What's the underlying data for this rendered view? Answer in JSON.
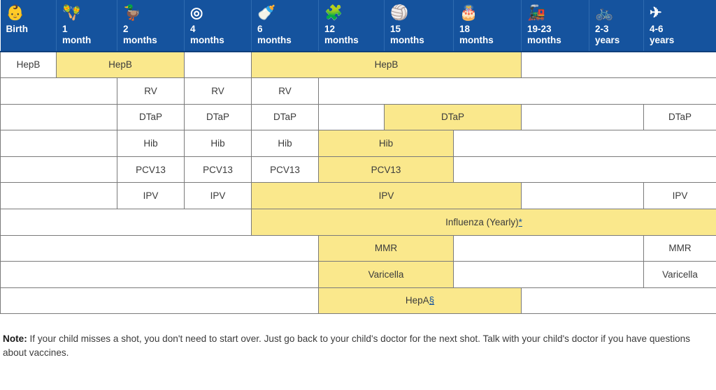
{
  "colors": {
    "header_blue": "#15539E",
    "highlight_yellow": "#FAE88C",
    "grid_line": "#7a7a7a",
    "link_blue": "#15539E"
  },
  "header": {
    "columns": [
      {
        "label": "Birth",
        "icon": "stroller-icon",
        "glyph": "👶"
      },
      {
        "label": "1\nmonth",
        "icon": "rattle-icon",
        "glyph": "🪇"
      },
      {
        "label": "2\nmonths",
        "icon": "rubber-duck-icon",
        "glyph": "🦆"
      },
      {
        "label": "4\nmonths",
        "icon": "teething-rings-icon",
        "glyph": "◎"
      },
      {
        "label": "6\nmonths",
        "icon": "bib-icon",
        "glyph": "🍼"
      },
      {
        "label": "12\nmonths",
        "icon": "building-blocks-icon",
        "glyph": "🧩"
      },
      {
        "label": "15\nmonths",
        "icon": "beach-ball-icon",
        "glyph": "🏐"
      },
      {
        "label": "18\nmonths",
        "icon": "stacking-rings-toy-icon",
        "glyph": "🎂"
      },
      {
        "label": "19-23\nmonths",
        "icon": "toy-train-icon",
        "glyph": "🚂"
      },
      {
        "label": "2-3\nyears",
        "icon": "tricycle-icon",
        "glyph": "🚲"
      },
      {
        "label": "4-6\nyears",
        "icon": "paper-airplane-icon",
        "glyph": "✈"
      }
    ]
  },
  "rows": [
    {
      "vaccine": "HepB",
      "cells": [
        {
          "label": "HepB",
          "span": 1,
          "highlight": false
        },
        {
          "label": "HepB",
          "span": 2,
          "highlight": true
        },
        {
          "label": "",
          "span": 1,
          "highlight": false
        },
        {
          "label": "HepB",
          "span": 4,
          "highlight": true
        },
        {
          "label": "",
          "span": 3,
          "highlight": false
        }
      ]
    },
    {
      "vaccine": "RV",
      "cells": [
        {
          "label": "",
          "span": 2,
          "highlight": false
        },
        {
          "label": "RV",
          "span": 1,
          "highlight": false
        },
        {
          "label": "RV",
          "span": 1,
          "highlight": false
        },
        {
          "label": "RV",
          "span": 1,
          "highlight": false
        },
        {
          "label": "",
          "span": 6,
          "highlight": false
        }
      ]
    },
    {
      "vaccine": "DTaP",
      "cells": [
        {
          "label": "",
          "span": 2,
          "highlight": false
        },
        {
          "label": "DTaP",
          "span": 1,
          "highlight": false
        },
        {
          "label": "DTaP",
          "span": 1,
          "highlight": false
        },
        {
          "label": "DTaP",
          "span": 1,
          "highlight": false
        },
        {
          "label": "",
          "span": 1,
          "highlight": false
        },
        {
          "label": "DTaP",
          "span": 2,
          "highlight": true
        },
        {
          "label": "",
          "span": 2,
          "highlight": false
        },
        {
          "label": "DTaP",
          "span": 1,
          "highlight": false
        }
      ]
    },
    {
      "vaccine": "Hib",
      "cells": [
        {
          "label": "",
          "span": 2,
          "highlight": false
        },
        {
          "label": "Hib",
          "span": 1,
          "highlight": false
        },
        {
          "label": "Hib",
          "span": 1,
          "highlight": false
        },
        {
          "label": "Hib",
          "span": 1,
          "highlight": false
        },
        {
          "label": "Hib",
          "span": 2,
          "highlight": true
        },
        {
          "label": "",
          "span": 4,
          "highlight": false
        }
      ]
    },
    {
      "vaccine": "PCV13",
      "cells": [
        {
          "label": "",
          "span": 2,
          "highlight": false
        },
        {
          "label": "PCV13",
          "span": 1,
          "highlight": false
        },
        {
          "label": "PCV13",
          "span": 1,
          "highlight": false
        },
        {
          "label": "PCV13",
          "span": 1,
          "highlight": false
        },
        {
          "label": "PCV13",
          "span": 2,
          "highlight": true
        },
        {
          "label": "",
          "span": 4,
          "highlight": false
        }
      ]
    },
    {
      "vaccine": "IPV",
      "cells": [
        {
          "label": "",
          "span": 2,
          "highlight": false
        },
        {
          "label": "IPV",
          "span": 1,
          "highlight": false
        },
        {
          "label": "IPV",
          "span": 1,
          "highlight": false
        },
        {
          "label": "IPV",
          "span": 4,
          "highlight": true
        },
        {
          "label": "",
          "span": 2,
          "highlight": false
        },
        {
          "label": "IPV",
          "span": 1,
          "highlight": false
        }
      ]
    },
    {
      "vaccine": "Influenza",
      "cells": [
        {
          "label": "",
          "span": 4,
          "highlight": false
        },
        {
          "label": "Influenza (Yearly)",
          "sup": "*",
          "span": 7,
          "highlight": true
        }
      ]
    },
    {
      "vaccine": "MMR",
      "cells": [
        {
          "label": "",
          "span": 5,
          "highlight": false
        },
        {
          "label": "MMR",
          "span": 2,
          "highlight": true
        },
        {
          "label": "",
          "span": 3,
          "highlight": false
        },
        {
          "label": "MMR",
          "span": 1,
          "highlight": false
        }
      ]
    },
    {
      "vaccine": "Varicella",
      "cells": [
        {
          "label": "",
          "span": 5,
          "highlight": false
        },
        {
          "label": "Varicella",
          "span": 2,
          "highlight": true
        },
        {
          "label": "",
          "span": 3,
          "highlight": false
        },
        {
          "label": "Varicella",
          "span": 1,
          "highlight": false
        }
      ]
    },
    {
      "vaccine": "HepA",
      "cells": [
        {
          "label": "",
          "span": 5,
          "highlight": false
        },
        {
          "label": "HepA",
          "sup": "§",
          "span": 3,
          "highlight": true
        },
        {
          "label": "",
          "span": 3,
          "highlight": false
        }
      ]
    }
  ],
  "note": {
    "label": "Note:",
    "text": " If your child misses a shot, you don't need to start over. Just go back to your child's doctor for the next shot. Talk with your child's doctor if you have questions about vaccines."
  }
}
